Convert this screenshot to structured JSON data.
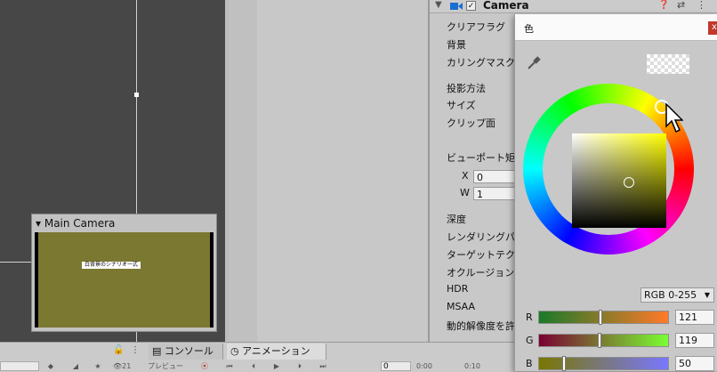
{
  "scene": {
    "camera_preview": {
      "title": "Main Camera",
      "screen_text": "白背景のシナリオ一式"
    }
  },
  "inspector": {
    "component_title": "Camera",
    "labels": {
      "clear_flags": "クリアフラグ",
      "background": "背景",
      "culling_mask": "カリングマスク",
      "projection": "投影方法",
      "size": "サイズ",
      "clipping": "クリップ面",
      "viewport_rect": "ビューポート矩形",
      "x": "X",
      "w": "W",
      "depth": "深度",
      "rendering_path": "レンダリングパス",
      "target_texture": "ターゲットテクスチ",
      "occlusion": "オクルージョンカリ",
      "hdr": "HDR",
      "msaa": "MSAA",
      "dynamic_resolution": "動的解像度を許"
    },
    "fields": {
      "x_value": "0",
      "w_value": "1"
    }
  },
  "color_picker": {
    "title": "色",
    "close_label": "x",
    "mode": "RGB 0-255",
    "channels": [
      {
        "label": "R",
        "value": "121",
        "fraction": 0.475,
        "gradient": [
          "#1a7a2a",
          "#ff7a2a"
        ]
      },
      {
        "label": "G",
        "value": "119",
        "fraction": 0.467,
        "gradient": [
          "#7a0032",
          "#7aff32"
        ]
      },
      {
        "label": "B",
        "value": "50",
        "fraction": 0.196,
        "gradient": [
          "#797700",
          "#7977ff"
        ]
      }
    ]
  },
  "bottom_bar": {
    "tabs": {
      "console": "コンソール",
      "animation": "アニメーション"
    },
    "layers_count": "21",
    "preview_label": "プレビュー",
    "frame_value": "0",
    "time_0": "0:00",
    "time_1": "0:10"
  },
  "colors": {
    "scene_bg": "#474747",
    "camera_view_bg": "#7b7832",
    "panel_bg": "#c8c8c8",
    "close_button": "#c0392b",
    "component_icon": "#1a6fd1"
  }
}
